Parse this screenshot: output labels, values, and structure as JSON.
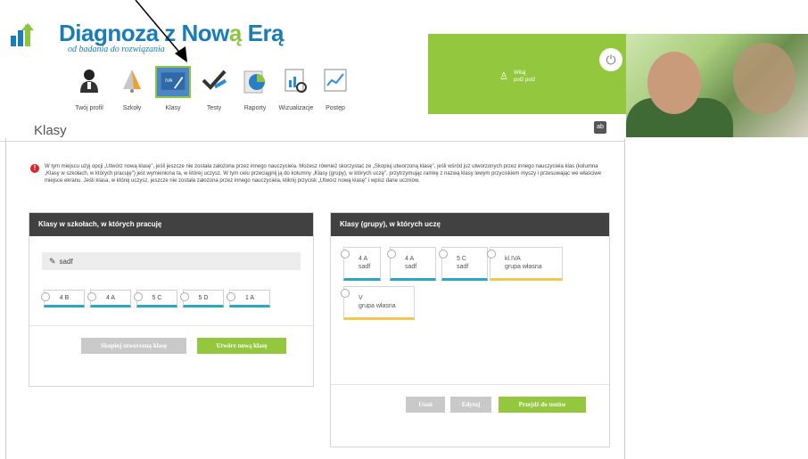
{
  "logo": {
    "title_main": "Diagnoza z Now",
    "title_accent": "ą",
    "title_end": " Erą",
    "subtitle": "od badania do rozwiązania"
  },
  "header": {
    "welcome_line1": "Witaj",
    "welcome_line2": "pol2 pol2",
    "power_icon": "power-icon"
  },
  "nav": {
    "items": [
      {
        "label": "Twój profil",
        "icon": "user-silhouette-icon"
      },
      {
        "label": "Szkoły",
        "icon": "school-bell-icon"
      },
      {
        "label": "Klasy",
        "icon": "class-board-icon"
      },
      {
        "label": "Testy",
        "icon": "test-pen-icon"
      },
      {
        "label": "Raporty",
        "icon": "report-chart-icon"
      },
      {
        "label": "Wizualizacje",
        "icon": "visualization-icon"
      },
      {
        "label": "Postęp",
        "icon": "progress-graph-icon"
      }
    ]
  },
  "page": {
    "title": "Klasy",
    "badge": "ab"
  },
  "info": {
    "text": "W tym miejscu użyj opcji „Utwórz nową klasę\", jeśli jeszcze nie została założona przez innego nauczyciela. Możesz również skorzystać ze „Skopiuj utworzoną klasę\", jeśli wśród już utworzonych przez innego nauczyciela klas (kolumna „Klasy w szkołach, w których pracuję\") jest wymieniona ta, w której uczysz. W tym celu przeciągnij ją do kolumny „Klasy (grupy), w których uczę\", przytrzymując ramkę z nazwą klasy lewym przyciskiem myszy i przesuwając we właściwe miejsce ekranu. Jeśli klasa, w której uczysz, jeszcze nie została założona przez innego nauczyciela, kliknij przycisk „Utwórz nową klasę\" i wpisz dane uczniów."
  },
  "left_panel": {
    "title": "Klasy w szkołach, w których pracuję",
    "school": "sadf",
    "classes": [
      "4 B",
      "4 A",
      "5 C",
      "5 D",
      "1 A"
    ],
    "copy_button": "Skopiuj utworzoną klasę",
    "new_button": "Utwórz nową klasę"
  },
  "right_panel": {
    "title": "Klasy (grupy), w których uczę",
    "cards": [
      {
        "name": "4 A",
        "sub": "sadf"
      },
      {
        "name": "4 A",
        "sub": "sadf"
      },
      {
        "name": "5 C",
        "sub": "sadf"
      },
      {
        "name": "kl.IVA",
        "sub": "grupa własna"
      },
      {
        "name": "V",
        "sub": "grupa własna"
      }
    ],
    "delete_button": "Usuń",
    "edit_button": "Edytuj",
    "go_button": "Przejdź do testów"
  }
}
